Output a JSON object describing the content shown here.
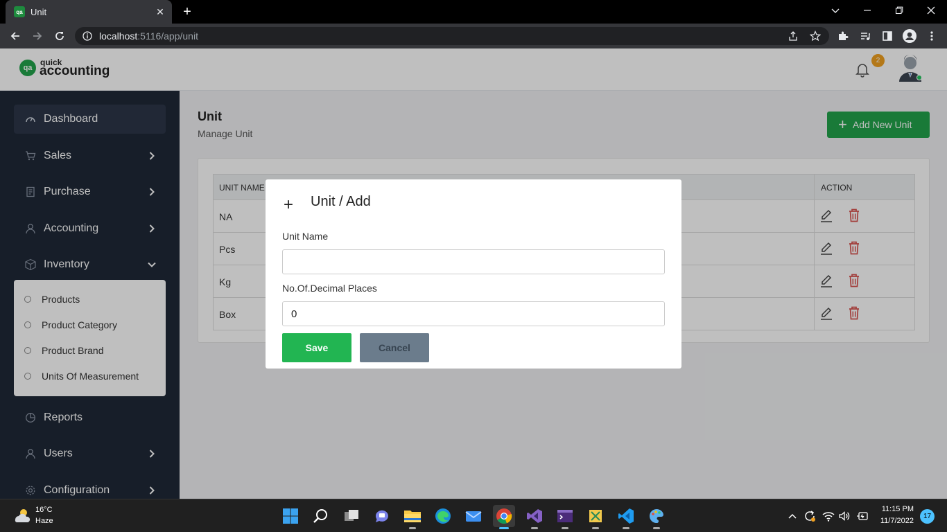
{
  "browser": {
    "tab_title": "Unit",
    "tab_favicon": "qa",
    "url_host": "localhost",
    "url_rest": ":5116/app/unit"
  },
  "app": {
    "logo_mark": "qa",
    "logo_small": "quick",
    "logo_big": "accounting",
    "notification_count": "2"
  },
  "sidebar": {
    "items": [
      {
        "label": "Dashboard",
        "icon": "dashboard-icon"
      },
      {
        "label": "Sales",
        "icon": "cart-icon"
      },
      {
        "label": "Purchase",
        "icon": "receipt-icon"
      },
      {
        "label": "Accounting",
        "icon": "person-icon"
      },
      {
        "label": "Inventory",
        "icon": "box-icon"
      },
      {
        "label": "Reports",
        "icon": "pie-chart-icon"
      },
      {
        "label": "Users",
        "icon": "user-icon"
      },
      {
        "label": "Configuration",
        "icon": "gear-icon"
      }
    ],
    "inventory_subitems": [
      {
        "label": "Products"
      },
      {
        "label": "Product Category"
      },
      {
        "label": "Product Brand"
      },
      {
        "label": "Units Of Measurement"
      }
    ]
  },
  "content": {
    "title": "Unit",
    "subtitle": "Manage Unit",
    "add_button": "Add New Unit",
    "table": {
      "col_name": "UNIT NAME",
      "col_action": "ACTION",
      "rows": [
        {
          "name": "NA"
        },
        {
          "name": "Pcs"
        },
        {
          "name": "Kg"
        },
        {
          "name": "Box"
        }
      ]
    }
  },
  "modal": {
    "title": "Unit / Add",
    "unit_name_label": "Unit Name",
    "unit_name_value": "",
    "decimal_label": "No.Of.Decimal Places",
    "decimal_value": "0",
    "save_label": "Save",
    "cancel_label": "Cancel"
  },
  "taskbar": {
    "temperature": "16°C",
    "condition": "Haze",
    "time": "11:15 PM",
    "date": "11/7/2022",
    "notification_count": "17"
  },
  "colors": {
    "brand_green": "#22a34b",
    "sidebar_bg": "#1f2937",
    "delete_red": "#d9534f"
  }
}
